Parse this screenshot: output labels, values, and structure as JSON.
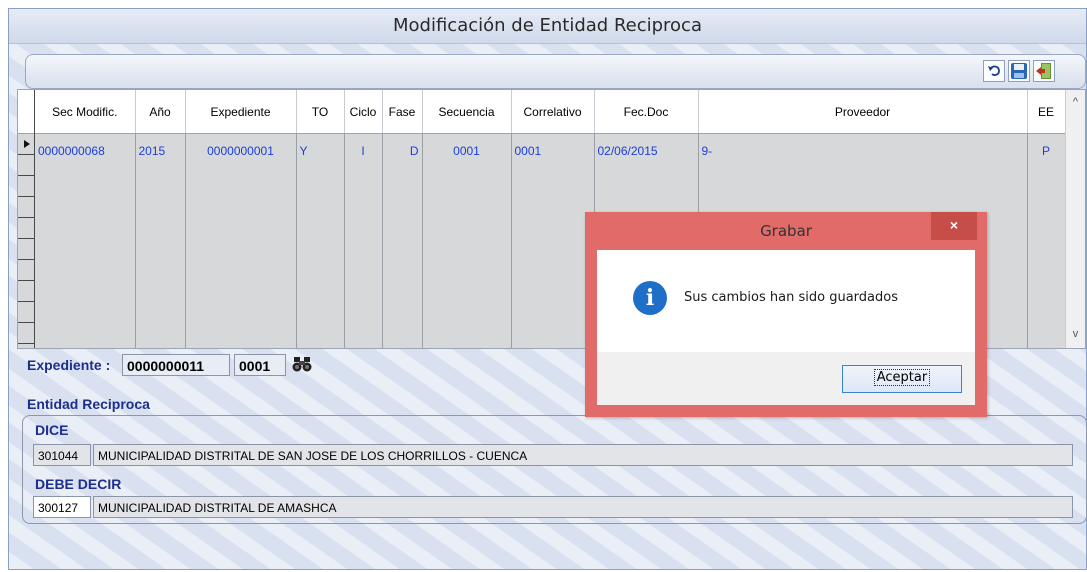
{
  "window": {
    "title": "Modificación de Entidad Reciproca"
  },
  "toolbar": {
    "buttons": [
      {
        "icon": "undo-icon"
      },
      {
        "icon": "save-icon"
      },
      {
        "icon": "exit-icon"
      }
    ]
  },
  "grid": {
    "columns": [
      "Sec Modific.",
      "Año",
      "Expediente",
      "TO",
      "Ciclo",
      "Fase",
      "Secuencia",
      "Correlativo",
      "Fec.Doc",
      "Proveedor",
      "EE"
    ],
    "rows": [
      [
        "0000000068",
        "2015",
        "0000000001",
        "Y",
        "I",
        "D",
        "0001",
        "0001",
        "02/06/2015",
        "9-",
        "P"
      ]
    ],
    "scroll_up": "^",
    "scroll_down": "v"
  },
  "expediente": {
    "label": "Expediente :",
    "number": "0000000011",
    "sequence": "0001"
  },
  "entidad": {
    "label": "Entidad Reciproca",
    "dice": {
      "label": "DICE",
      "code": "301044",
      "name": "MUNICIPALIDAD DISTRITAL DE SAN JOSE DE LOS CHORRILLOS - CUENCA"
    },
    "debe_decir": {
      "label": "DEBE DECIR",
      "code": "300127",
      "name": "MUNICIPALIDAD DISTRITAL DE AMASHCA"
    }
  },
  "dialog": {
    "title": "Grabar",
    "close": "×",
    "icon_glyph": "i",
    "message": "Sus cambios han sido guardados",
    "ok_label": "Aceptar"
  }
}
